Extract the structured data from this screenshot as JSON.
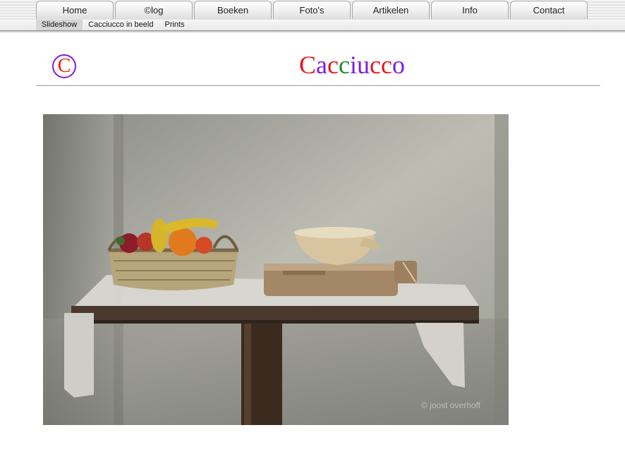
{
  "nav": {
    "tabs": [
      {
        "label": "Home"
      },
      {
        "label": "©log"
      },
      {
        "label": "Boeken"
      },
      {
        "label": "Foto's"
      },
      {
        "label": "Artikelen"
      },
      {
        "label": "Info"
      },
      {
        "label": "Contact"
      }
    ],
    "subtabs": [
      {
        "label": "Slideshow",
        "active": true
      },
      {
        "label": "Cacciucco in beeld",
        "active": false
      },
      {
        "label": "Prints",
        "active": false
      }
    ]
  },
  "header": {
    "logo": "C",
    "title_letters": [
      {
        "char": "C",
        "color": "#e8151a"
      },
      {
        "char": "a",
        "color": "#7a1fe0"
      },
      {
        "char": "c",
        "color": "#e8151a"
      },
      {
        "char": "c",
        "color": "#1a8c2a"
      },
      {
        "char": "i",
        "color": "#7a1fe0"
      },
      {
        "char": "u",
        "color": "#7a1fe0"
      },
      {
        "char": "c",
        "color": "#e8151a"
      },
      {
        "char": "c",
        "color": "#e8151a"
      },
      {
        "char": "o",
        "color": "#7a1fe0"
      }
    ]
  },
  "photo": {
    "credit": "© joost overhoff"
  }
}
